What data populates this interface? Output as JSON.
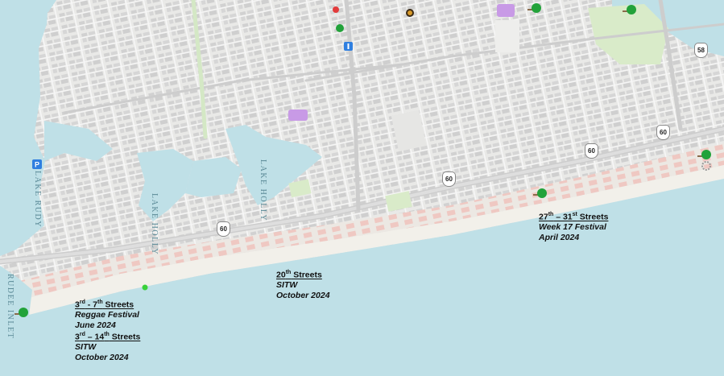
{
  "colors": {
    "ocean": "#bfe0e7",
    "beach": "#f1efe8",
    "land": "#ebebe9",
    "road": "#d6d6d6",
    "building": "#d2d2d2",
    "beach_building": "#efcfc9",
    "park": "#d9ebc9",
    "label_text": "#111111",
    "water_label": "#5b8a97",
    "tree_icon": "#22a23a"
  },
  "water_labels": {
    "lake_rudy": "LAKE RUDY",
    "lake_holly_1": "LAKE HOLLY",
    "lake_holly_2": "LAKE HOLLY",
    "rudee_inlet": "RUDEE INLET"
  },
  "route_shields": [
    "60",
    "60",
    "60",
    "60",
    "58"
  ],
  "event_labels": [
    {
      "streets_parts": [
        "3",
        "rd",
        " - 7",
        "th",
        " Streets"
      ],
      "name": "Reggae Festival",
      "date": "June 2024"
    },
    {
      "streets_parts": [
        "3",
        "rd",
        " – 14",
        "th",
        " Streets"
      ],
      "name": "SITW",
      "date": "October 2024"
    },
    {
      "streets_parts": [
        "20",
        "th",
        " Streets",
        "",
        ""
      ],
      "name": "SITW",
      "date": "October 2024"
    },
    {
      "streets_parts": [
        "27",
        "th",
        " – 31",
        "st",
        " Streets"
      ],
      "name": "Week 17 Festival",
      "date": "April 2024"
    }
  ],
  "icons": [
    "tree-icon",
    "tree-icon",
    "tree-icon",
    "tree-icon",
    "tree-icon",
    "tree-icon",
    "parking-icon",
    "info-icon",
    "poi-marker-icon"
  ]
}
